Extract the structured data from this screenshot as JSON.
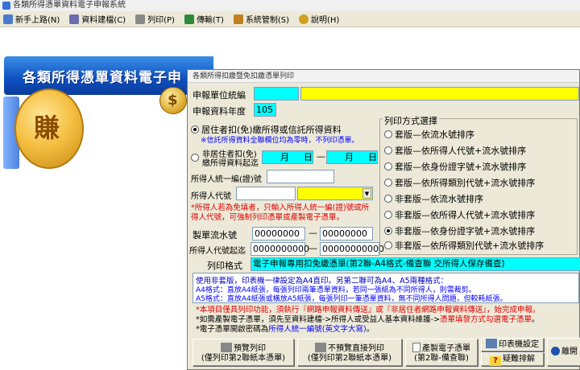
{
  "window": {
    "title": "各類所得憑單資料電子申報系統"
  },
  "menu": [
    {
      "label": "新手上路(N)",
      "icon": "file-icon",
      "color": "#4a7bd0"
    },
    {
      "label": "資料建檔(C)",
      "icon": "grid-icon",
      "color": "#6b6bb0"
    },
    {
      "label": "列印(P)",
      "icon": "printer-icon",
      "color": "#777777"
    },
    {
      "label": "傳輸(T)",
      "icon": "transfer-icon",
      "color": "#2d8a3a"
    },
    {
      "label": "系統管制(S)",
      "icon": "gear-user-icon",
      "color": "#c08020"
    },
    {
      "label": "說明(H)",
      "icon": "help-icon",
      "color": "#d0a020"
    }
  ],
  "banner": {
    "text": "各類所得憑單資料電子申",
    "coin_glyph": "賺",
    "small_coin_glyph": "$"
  },
  "dialog": {
    "title": "各類所得扣繳暨免扣繳憑單列印",
    "unit_id_label": "申報單位統編",
    "unit_id_value": "",
    "year_label": "申報資料年度",
    "year_value": "105",
    "resident_label": "居住者扣(免)繳所得或信託所得資料",
    "resident_note": "※信託所得資料全聯欄位均為零時，不列印憑單。",
    "nonresident_label1": "非居住者扣(免)",
    "nonresident_label2": "繳所得資料起迄",
    "month_label": "月",
    "day_label": "日",
    "range_sep": "—",
    "taxpayer_id_label": "所得人統一編(證)號",
    "taxpayer_id_value": "",
    "taxpayer_code_label": "所得人代號",
    "taxpayer_code_value": "",
    "red_note": "*所得人若為免填者，只輸入所得人統一編(證)號或所得人代號，可強制列印憑單或產製電子憑單。",
    "serial_label": "製單流水號",
    "serial_from": "00000000",
    "serial_to": "00000000",
    "code_range_label": "所得人代號起迄",
    "code_from": "0000000000",
    "code_to": "00000000000",
    "print_method_title": "列印方式選擇",
    "print_options": [
      {
        "label": "套版—依流水號排序",
        "selected": false
      },
      {
        "label": "套版—依所得人代號+流水號排序",
        "selected": false
      },
      {
        "label": "套版—依身份證字號+流水號排序",
        "selected": false
      },
      {
        "label": "套版—依所得類別代號+流水號排序",
        "selected": false
      },
      {
        "label": "非套版—依流水號排序",
        "selected": false
      },
      {
        "label": "非套版—依所得人代號+流水號排序",
        "selected": false
      },
      {
        "label": "非套版—依身份證字號+流水號排序",
        "selected": true
      },
      {
        "label": "非套版—依所得類別代號+流水號排序",
        "selected": false
      }
    ],
    "format_label": "列印格式",
    "format_value": "電子申報專用扣免繳憑單(第2聯-A4格式-備查聯 交所得人保存備查)",
    "info_line1": "使用非套版，印表機一律設定為A4直印。另第二聯可為A4、A5兩種格式：",
    "info_line2": "A4格式：直放A4紙張，每張列印兩筆憑單資料，若同一張紙為不同所得人，則需裁剪。",
    "info_line3": "A5格式：直放A4紙張或橫放A5紙張，每張列印一筆憑單資料，無不同所得人問題，但較耗紙張。",
    "note1": "*本項目僅具列印功能，須執行『網路申報資料傳送』或『非居住者網路申報資料傳送』，始完成申報。",
    "note2_a": "*如需產製電子憑單，須先至資料建檔->所得人或受益人基本資料維護->",
    "note2_b": "憑單填發方式勾選電子憑單",
    "note2_c": "。",
    "note3_a": "*電子憑單開啟密碼為",
    "note3_b": "所得人統一編號(英文字大寫)",
    "note3_c": "。",
    "buttons": {
      "preview_line1": "預覽列印",
      "preview_line2": "(僅列印第2聯紙本憑單)",
      "direct_line1": "不預覽直接列印",
      "direct_line2": "(僅列印第2聯紙本憑單)",
      "ecert_line1": "產製電子憑單",
      "ecert_line2": "(第2聯-備查聯)",
      "printer_setup": "印表機設定",
      "troubleshoot": "疑難排解",
      "exit": "離開"
    }
  }
}
